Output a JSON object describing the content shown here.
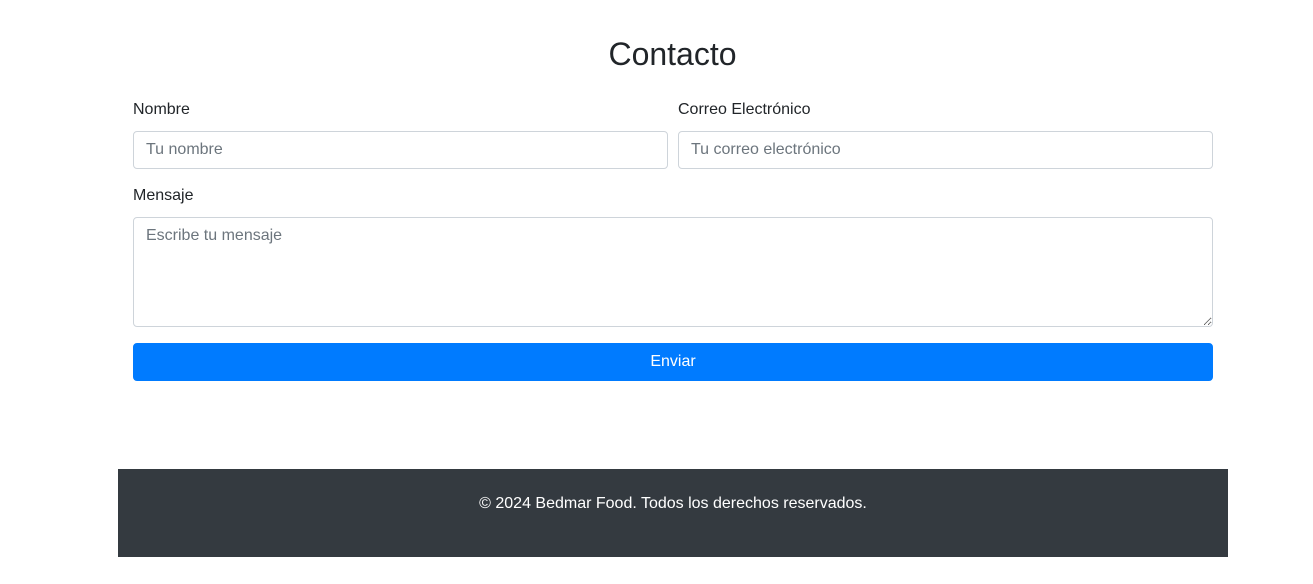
{
  "page": {
    "title": "Contacto"
  },
  "form": {
    "name": {
      "label": "Nombre",
      "placeholder": "Tu nombre",
      "value": ""
    },
    "email": {
      "label": "Correo Electrónico",
      "placeholder": "Tu correo electrónico",
      "value": ""
    },
    "message": {
      "label": "Mensaje",
      "placeholder": "Escribe tu mensaje",
      "value": ""
    },
    "submit_label": "Enviar"
  },
  "footer": {
    "text": "© 2024 Bedmar Food. Todos los derechos reservados."
  },
  "colors": {
    "primary": "#007bff",
    "footer_bg": "#343a40",
    "border": "#ced4da"
  }
}
